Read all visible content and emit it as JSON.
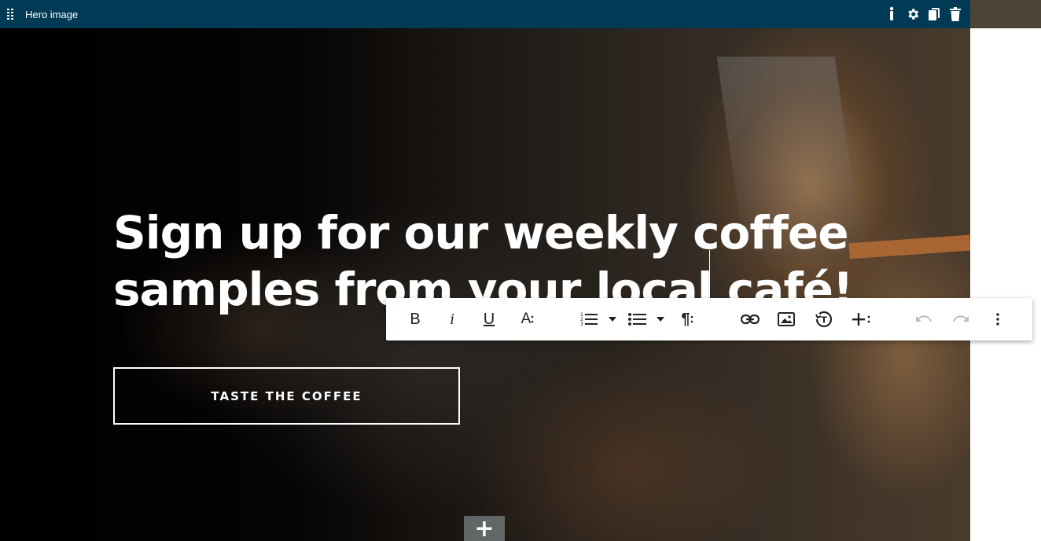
{
  "block_bar": {
    "title": "Hero image",
    "icons": [
      "drag-handle-icon",
      "accessibility-icon",
      "gear-icon",
      "copy-icon",
      "trash-icon"
    ]
  },
  "hero": {
    "headline": "Sign up for our weekly coffee samples from your local café!",
    "cta_label": "TASTE THE COFFEE"
  },
  "toolbar": {
    "bold_label": "B",
    "italic_label": "i",
    "underline_label": "U",
    "font_size_label": "A",
    "paragraph_label": "¶",
    "icons": [
      "bold-icon",
      "italic-icon",
      "underline-icon",
      "font-size-icon",
      "ordered-list-icon",
      "ordered-list-dropdown-icon",
      "unordered-list-icon",
      "unordered-list-dropdown-icon",
      "paragraph-format-icon",
      "link-icon",
      "image-icon",
      "clear-format-icon",
      "insert-more-icon",
      "undo-icon",
      "redo-icon",
      "more-options-icon"
    ]
  },
  "add_block": {
    "label": "+"
  },
  "colors": {
    "top_bar": "#003a55",
    "toolbar_bg": "#ffffff",
    "hero_text": "#ffffff"
  }
}
